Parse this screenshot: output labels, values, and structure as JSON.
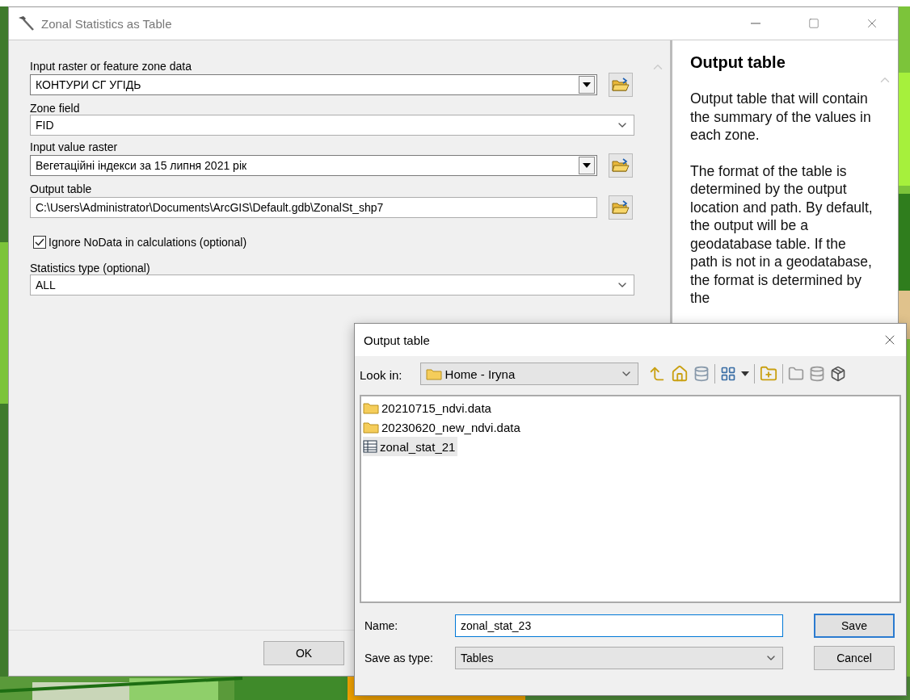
{
  "window": {
    "title": "Zonal Statistics as Table"
  },
  "form": {
    "params": [
      {
        "kind": "combo",
        "label": "Input raster or feature zone data",
        "value": "КОНТУРИ СГ УГІДЬ"
      },
      {
        "kind": "dropdown",
        "label": "Zone field",
        "value": "FID"
      },
      {
        "kind": "combo",
        "label": "Input value raster",
        "value": "Вегетаційні індекси за 15 липня 2021 рік"
      },
      {
        "kind": "text",
        "label": "Output table",
        "value": "C:\\Users\\Administrator\\Documents\\ArcGIS\\Default.gdb\\ZonalSt_shp7"
      },
      {
        "kind": "checkbox",
        "label": "Ignore NoData in calculations (optional)",
        "checked": true
      },
      {
        "kind": "dropdown",
        "label": "Statistics type (optional)",
        "value": "ALL"
      }
    ],
    "ok_button": "OK"
  },
  "help": {
    "title": "Output table",
    "paragraphs": [
      "Output table that will contain the summary of the values in each zone.",
      "The format of the table is determined by the output location and path. By default, the output will be a geodatabase table. If the path is not in a geodatabase, the format is determined by the"
    ]
  },
  "dialog": {
    "title": "Output table",
    "look_in": {
      "label": "Look in:",
      "value": "Home - Iryna"
    },
    "items": [
      {
        "kind": "folder",
        "name": "20210715_ndvi.data",
        "selected": false
      },
      {
        "kind": "folder",
        "name": "20230620_new_ndvi.data",
        "selected": false
      },
      {
        "kind": "table",
        "name": "zonal_stat_21",
        "selected": true
      }
    ],
    "name": {
      "label": "Name:",
      "value": "zonal_stat_23"
    },
    "type": {
      "label": "Save as type:",
      "value": "Tables"
    },
    "buttons": [
      {
        "label": "Save",
        "default": true
      },
      {
        "label": "Cancel",
        "default": false
      }
    ]
  }
}
